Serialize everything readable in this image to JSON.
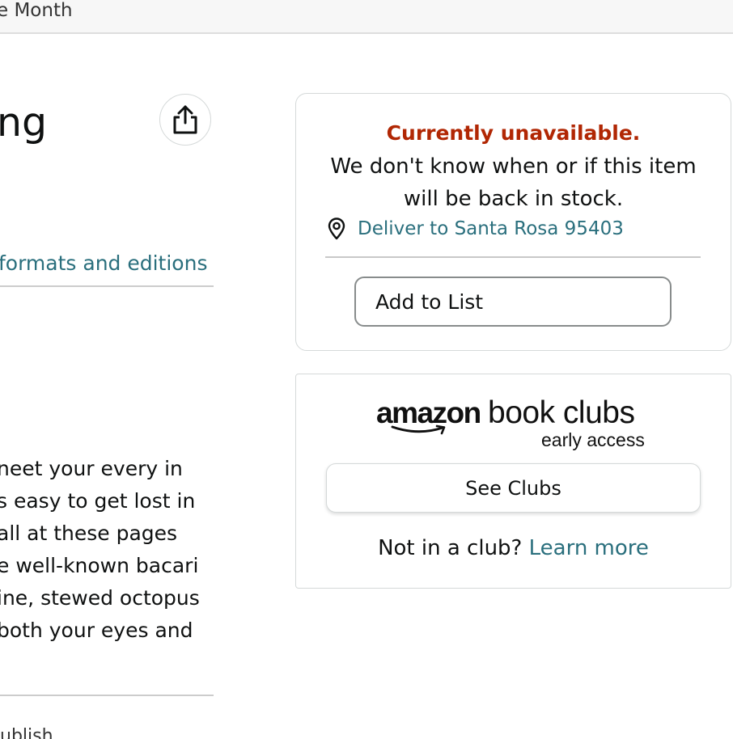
{
  "topbar": {
    "text": "e Month"
  },
  "product": {
    "title_fragment": "ng",
    "formats_link": "formats and editions",
    "description_lines": [
      "neet your every in",
      "s easy to get lost in",
      "all at these pages",
      "e well-known bacari",
      "ine, stewed octopus",
      "both your eyes and"
    ],
    "bottom_fragment": "ublish"
  },
  "buybox": {
    "unavailable": "Currently unavailable.",
    "stock_message": "We don't know when or if this item will be back in stock.",
    "deliver_to": "Deliver to Santa Rosa 95403",
    "add_to_list": "Add to List"
  },
  "book_clubs": {
    "logo_amazon": "amazon",
    "logo_book_clubs": "book clubs",
    "logo_early_access": "early access",
    "see_clubs": "See Clubs",
    "not_in_club": "Not in a club?",
    "learn_more": "Learn more"
  },
  "colors": {
    "link": "#2a6f7d",
    "unavailable": "#b12704",
    "text": "#0f1111"
  },
  "icons": {
    "share": "share-icon",
    "location": "location-pin-icon",
    "smile": "amazon-smile-icon"
  }
}
